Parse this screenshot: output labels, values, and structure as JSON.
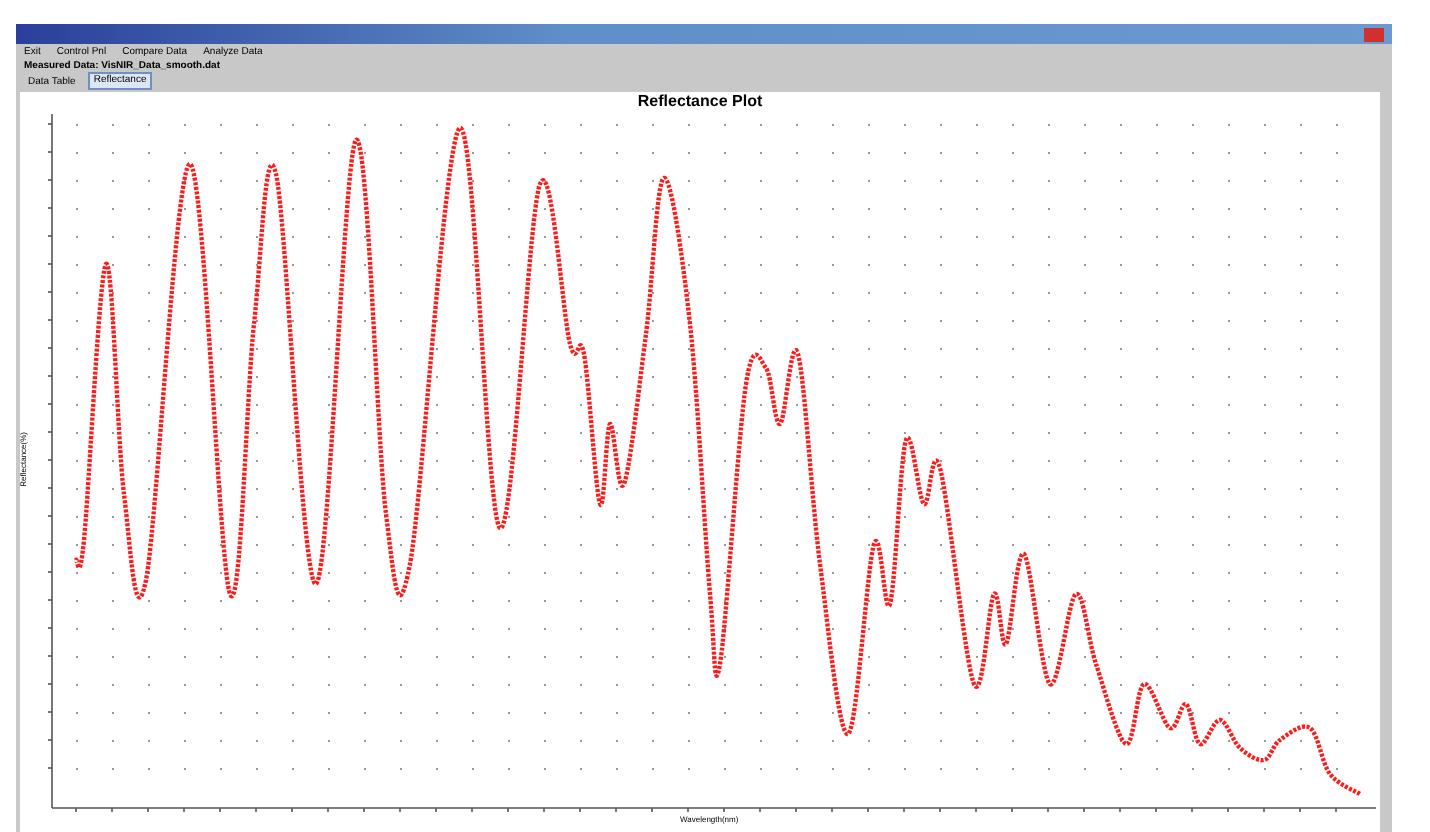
{
  "menu": [
    {
      "label": "Exit"
    },
    {
      "label": "Control Pnl"
    },
    {
      "label": "Compare Data"
    },
    {
      "label": "Analyze Data"
    }
  ],
  "file_line": "Measured Data: VisNIR_Data_smooth.dat",
  "tabs": [
    {
      "label": "Data Table",
      "selected": false
    },
    {
      "label": "Reflectance",
      "selected": true
    }
  ],
  "plot": {
    "title": "Reflectance Plot",
    "xlabel": "Wavelength(nm)",
    "ylabel": "Reflectance(%)"
  }
}
